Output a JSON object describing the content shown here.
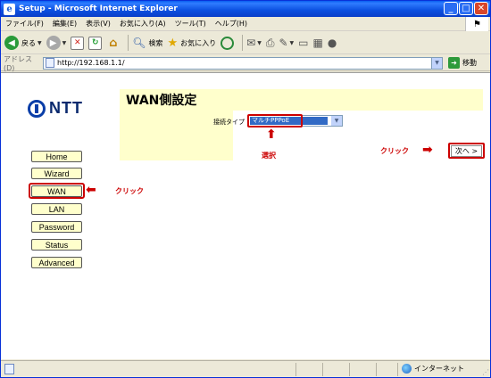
{
  "window": {
    "title": "Setup - Microsoft Internet Explorer",
    "minimize": "_",
    "maximize": "□",
    "close": "✕"
  },
  "menu": [
    "ファイル(F)",
    "編集(E)",
    "表示(V)",
    "お気に入り(A)",
    "ツール(T)",
    "ヘルプ(H)"
  ],
  "toolbar": {
    "back_label": "戻る",
    "search_label": "検索",
    "favorites_label": "お気に入り"
  },
  "address": {
    "label": "アドレス(D)",
    "url": "http://192.168.1.1/",
    "go_label": "移動"
  },
  "page": {
    "logo_text": "NTT",
    "title": "WAN側設定",
    "connection_type_label": "接続タイプ",
    "connection_type_value": "マルチPPPoE",
    "next_button": "次へ >",
    "nav": [
      "Home",
      "Wizard",
      "WAN",
      "LAN",
      "Password",
      "Status",
      "Advanced"
    ]
  },
  "annotations": {
    "select_label": "選択",
    "click_label": "クリック",
    "highlight_color": "#cc0000"
  },
  "statusbar": {
    "zone": "インターネット"
  }
}
